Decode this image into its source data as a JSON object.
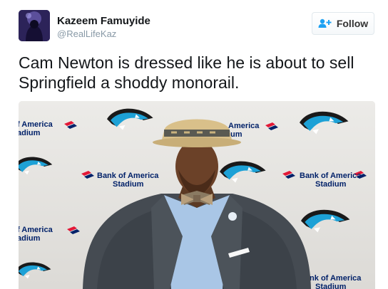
{
  "tweet": {
    "author_name": "Kazeem Famuyide",
    "author_handle": "@RealLifeKaz",
    "follow_label": "Follow",
    "text_line1": "Cam Newton is dressed like he is about to sell",
    "text_line2": "Springfield a shoddy monorail."
  },
  "media": {
    "backdrop_sponsor_line1": "Bank of America",
    "backdrop_sponsor_line2": "Stadium",
    "partial_left_line1": "f America",
    "partial_left_line2": "adium",
    "partial_mid_line1": "America",
    "partial_mid_line2": "ium",
    "partial_low_line1": "m"
  },
  "colors": {
    "panthers_blue": "#1da1d6",
    "panthers_black": "#1a1a1a",
    "boa_red": "#e31837",
    "boa_navy": "#012169",
    "follow_icon_blue": "#1da1f2"
  }
}
